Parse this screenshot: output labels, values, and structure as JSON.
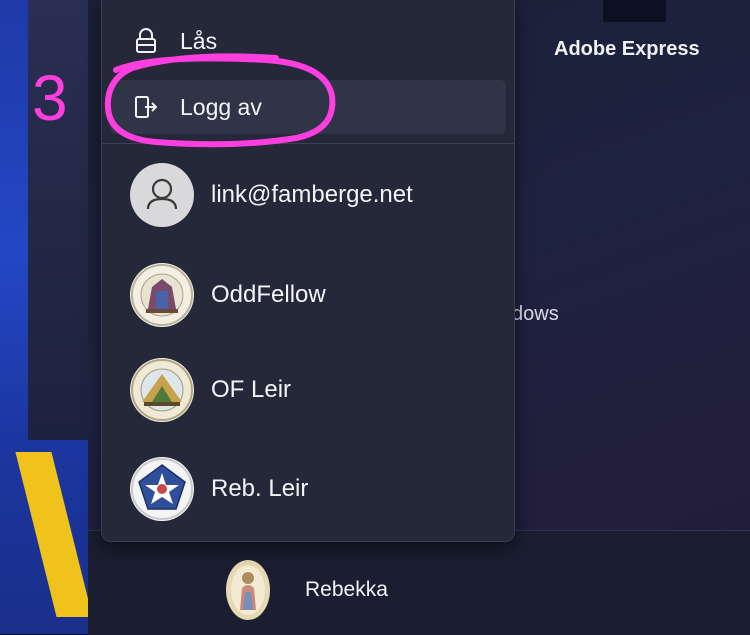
{
  "annotation": {
    "step_number": "3",
    "highlight_color": "#ff3ee0"
  },
  "start_menu": {
    "pinned_app_label": "Adobe Express",
    "partial_label": "dows"
  },
  "power_flyout": {
    "items": [
      {
        "label": "Lås",
        "icon": "lock-icon"
      },
      {
        "label": "Logg av",
        "icon": "sign-out-icon"
      }
    ],
    "accounts": [
      {
        "label": "link@famberge.net",
        "avatar": "default-person-avatar"
      },
      {
        "label": "OddFellow",
        "avatar": "oddfellow-emblem-avatar"
      },
      {
        "label": "OF Leir",
        "avatar": "of-leir-emblem-avatar"
      },
      {
        "label": "Reb. Leir",
        "avatar": "reb-leir-emblem-avatar"
      }
    ]
  },
  "footer": {
    "current_user": "Rebekka",
    "avatar": "rebekka-emblem-avatar"
  },
  "colors": {
    "flyout_bg": "#242839",
    "hover_bg": "#2f3446",
    "wallpaper_blue": "#2347c4",
    "wallpaper_yellow": "#f3c21a"
  }
}
